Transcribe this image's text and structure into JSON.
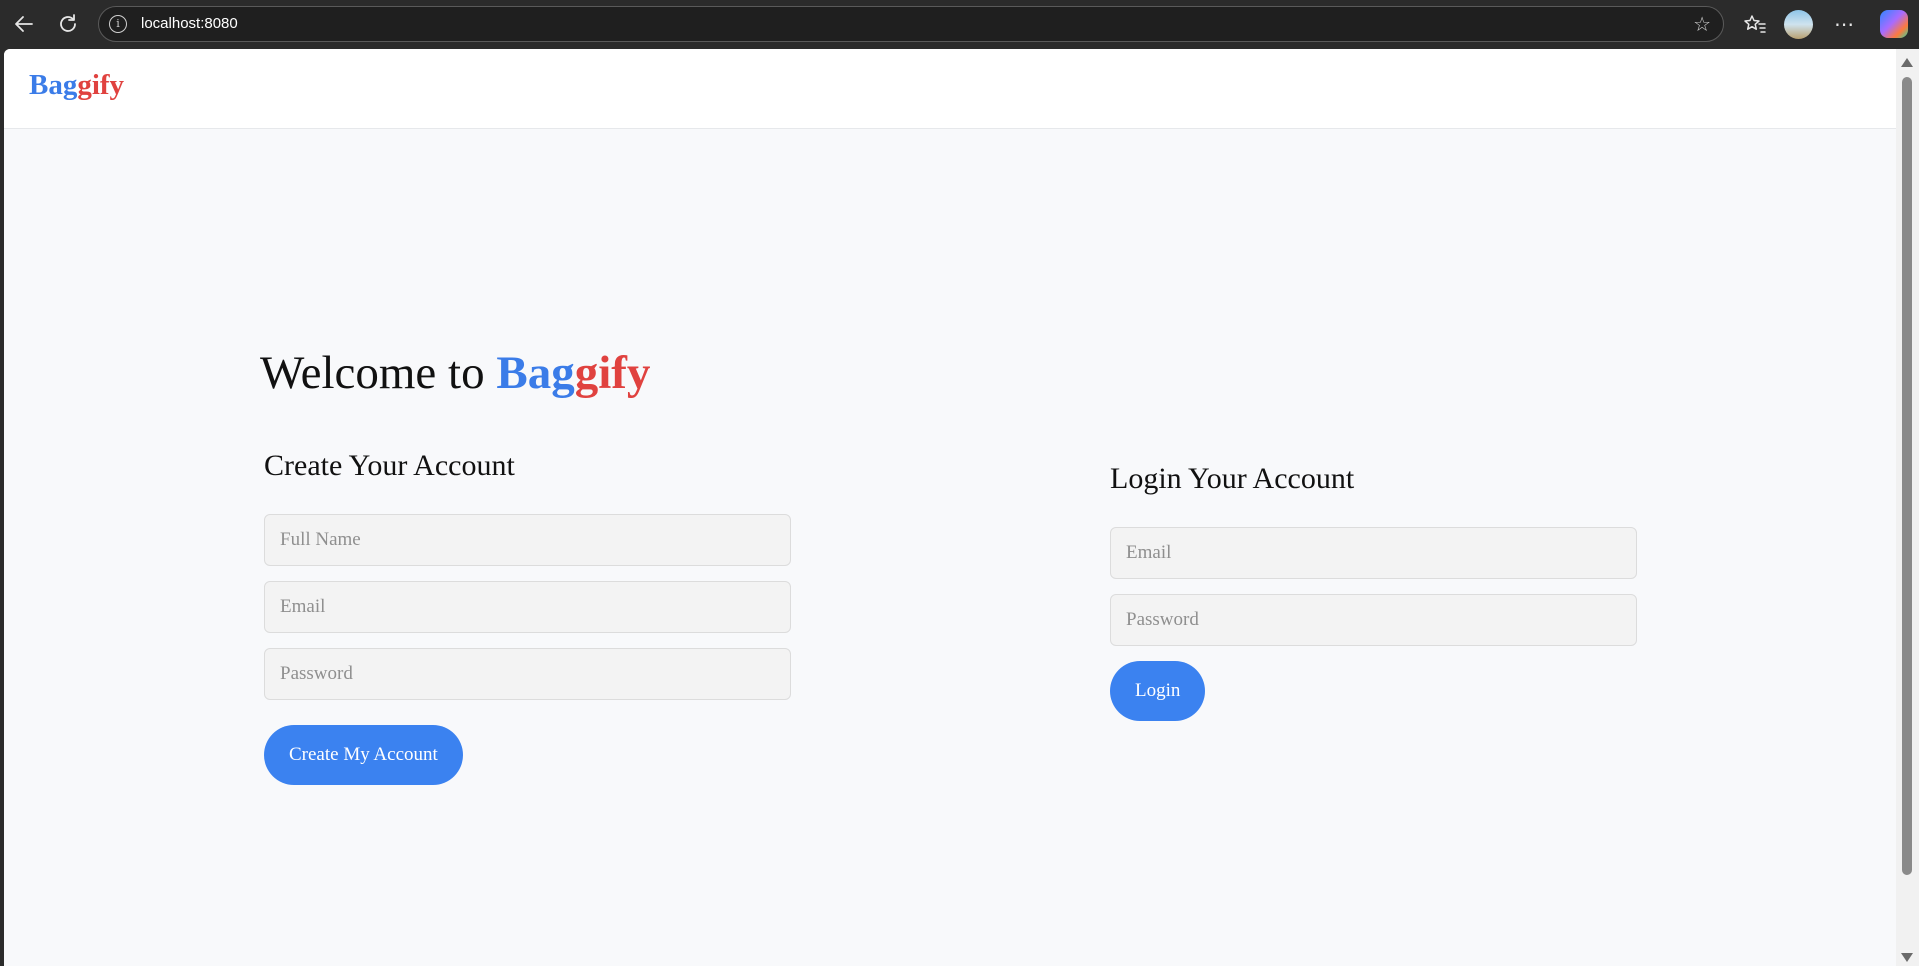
{
  "browser": {
    "url": "localhost:8080",
    "back_icon": "back-arrow-icon",
    "refresh_icon": "refresh-icon",
    "favorite_icon": "star-icon",
    "favorites_icon": "favorites-list-icon",
    "menu_icon": "more-icon"
  },
  "navbar": {
    "brand_part1": "Bag",
    "brand_part2": "gify"
  },
  "welcome": {
    "prefix": "Welcome to ",
    "brand_part1": "Bag",
    "brand_part2": "gify"
  },
  "signup": {
    "title": "Create Your Account",
    "full_name_placeholder": "Full Name",
    "email_placeholder": "Email",
    "password_placeholder": "Password",
    "submit_label": "Create My Account"
  },
  "login": {
    "title": "Login Your Account",
    "email_placeholder": "Email",
    "password_placeholder": "Password",
    "submit_label": "Login"
  },
  "colors": {
    "brand_blue": "#3b7ce8",
    "brand_red": "#e0423f",
    "button_blue": "#3b82f0",
    "page_background": "#f8f9fb"
  }
}
